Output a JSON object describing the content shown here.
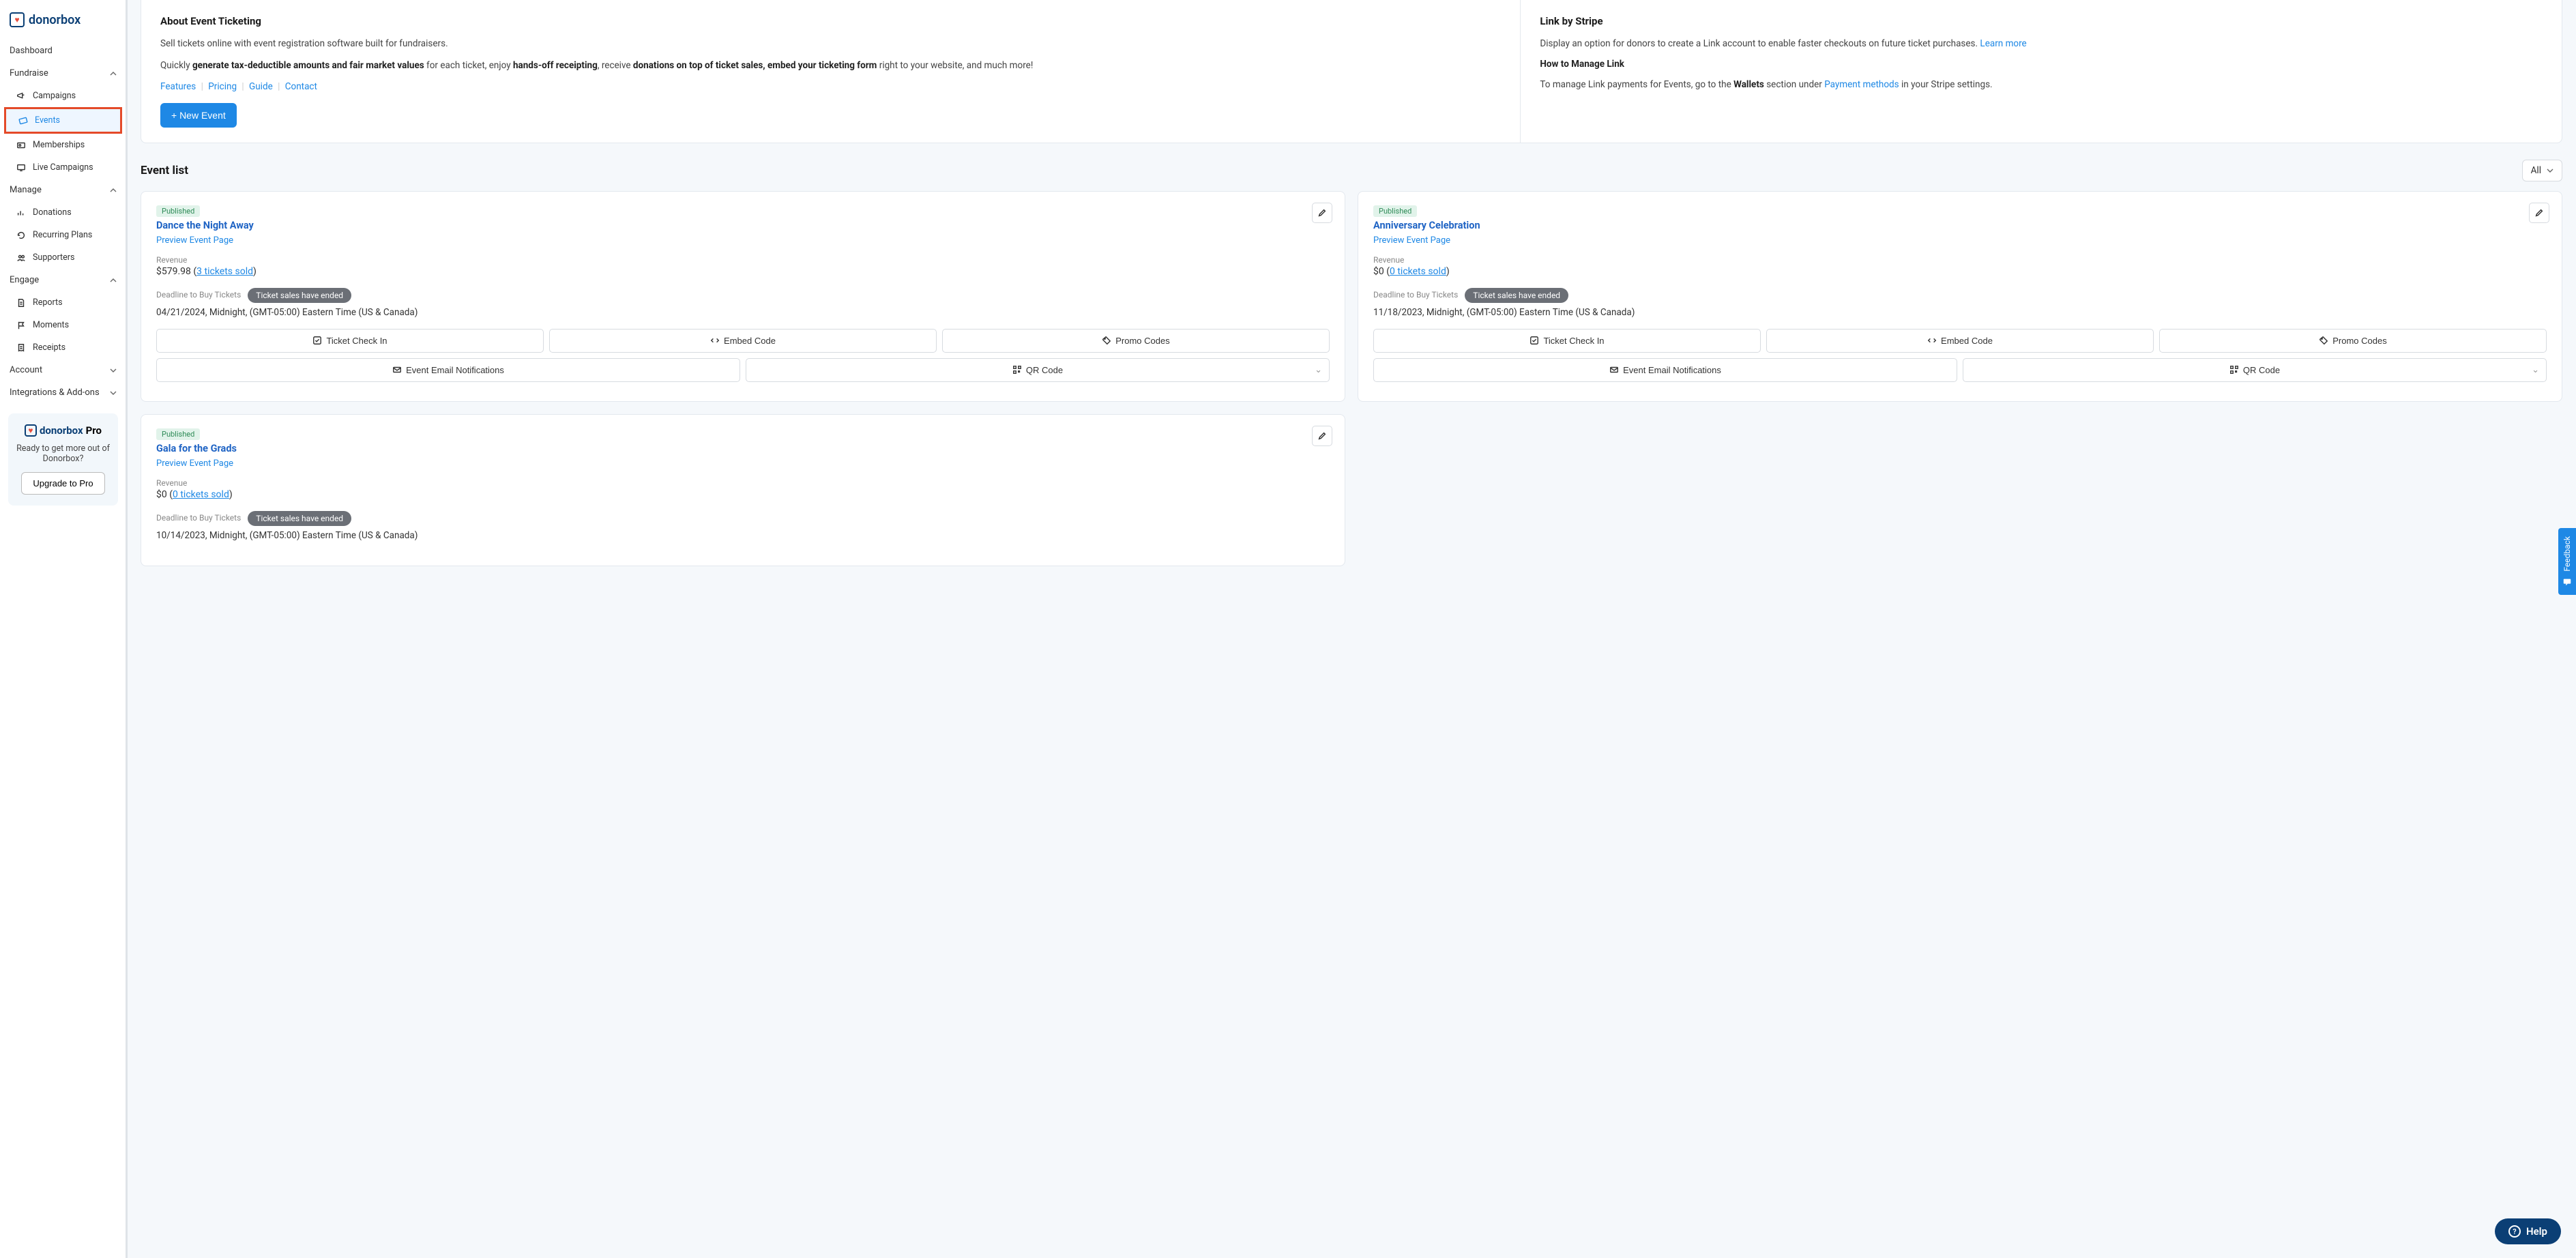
{
  "brand": {
    "name": "donorbox",
    "pro": "Pro"
  },
  "sidebar": {
    "dashboard": "Dashboard",
    "fundraise": {
      "label": "Fundraise",
      "items": [
        "Campaigns",
        "Events",
        "Memberships",
        "Live Campaigns"
      ]
    },
    "manage": {
      "label": "Manage",
      "items": [
        "Donations",
        "Recurring Plans",
        "Supporters"
      ]
    },
    "engage": {
      "label": "Engage",
      "items": [
        "Reports",
        "Moments",
        "Receipts"
      ]
    },
    "account": "Account",
    "integrations": "Integrations & Add-ons",
    "promo": {
      "title_pre": "donorbox",
      "title_post": "Pro",
      "text": "Ready to get more out of Donorbox?",
      "cta": "Upgrade to Pro"
    }
  },
  "about": {
    "title": "About Event Ticketing",
    "p1": "Sell tickets online with event registration software built for fundraisers.",
    "p2_a": "Quickly ",
    "p2_b": "generate tax-deductible amounts and fair market values",
    "p2_c": " for each ticket, enjoy ",
    "p2_d": "hands-off receipting",
    "p2_e": ", receive ",
    "p2_f": "donations on top of ticket sales, embed your ticketing form",
    "p2_g": " right to your website, and much more!",
    "links": {
      "features": "Features",
      "pricing": "Pricing",
      "guide": "Guide",
      "contact": "Contact"
    },
    "new_event": "+ New Event"
  },
  "linkbox": {
    "title": "Link by Stripe",
    "p1": "Display an option for donors to create a Link account to enable faster checkouts on future ticket purchases.  ",
    "learn": "Learn more",
    "howto": "How to Manage Link",
    "p2_a": "To manage Link payments for Events, go to the ",
    "p2_b": "Wallets",
    "p2_c": " section under ",
    "p2_d": "Payment methods",
    "p2_e": " in your Stripe settings."
  },
  "list": {
    "title": "Event list",
    "filter": "All"
  },
  "labels_common": {
    "published": "Published",
    "preview": "Preview Event Page",
    "revenue": "Revenue",
    "deadline": "Deadline to Buy Tickets",
    "ended": "Ticket sales have ended",
    "checkin": "Ticket Check In",
    "embed": "Embed Code",
    "promo": "Promo Codes",
    "email": "Event Email Notifications",
    "qr": "QR Code"
  },
  "events": [
    {
      "title": "Dance the Night Away",
      "revenue_amount": "$579.98",
      "tickets_sold": "3 tickets sold",
      "deadline": "04/21/2024, Midnight, (GMT-05:00) Eastern Time (US & Canada)"
    },
    {
      "title": "Anniversary Celebration",
      "revenue_amount": "$0",
      "tickets_sold": "0 tickets sold",
      "deadline": "11/18/2023, Midnight, (GMT-05:00) Eastern Time (US & Canada)"
    },
    {
      "title": "Gala for the Grads",
      "revenue_amount": "$0",
      "tickets_sold": "0 tickets sold",
      "deadline": "10/14/2023, Midnight, (GMT-05:00) Eastern Time (US & Canada)"
    }
  ],
  "feedback": "Feedback",
  "help": "Help"
}
